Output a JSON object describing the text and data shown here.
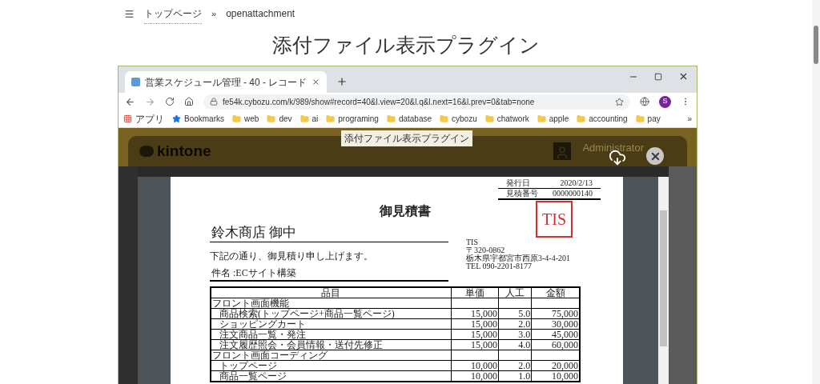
{
  "breadcrumb": {
    "items": [
      {
        "label": "トップページ",
        "kind": "link"
      },
      {
        "label": "openattachment",
        "kind": "current"
      }
    ],
    "separator": "»"
  },
  "page_title": "添付ファイル表示プラグイン",
  "browser": {
    "tab_title": "営業スケジュール管理 - 40 - レコード",
    "url": "fe54k.cybozu.com/k/989/show#record=40&l.view=20&l.q&l.next=16&l.prev=0&tab=none",
    "profile_letter": "S",
    "more_bookmarks": "»",
    "bookmarks": [
      {
        "label": "アプリ",
        "kind": "apps"
      },
      {
        "label": "Bookmarks",
        "kind": "star"
      },
      {
        "label": "web",
        "kind": "folder"
      },
      {
        "label": "dev",
        "kind": "folder"
      },
      {
        "label": "ai",
        "kind": "folder"
      },
      {
        "label": "programing",
        "kind": "folder"
      },
      {
        "label": "database",
        "kind": "folder"
      },
      {
        "label": "cybozu",
        "kind": "folder"
      },
      {
        "label": "chatwork",
        "kind": "folder"
      },
      {
        "label": "apple",
        "kind": "folder"
      },
      {
        "label": "accounting",
        "kind": "folder"
      },
      {
        "label": "pay",
        "kind": "folder"
      }
    ]
  },
  "app": {
    "logo": "kintone",
    "user": "Administrator",
    "tooltip": "添付ファイル表示プラグイン"
  },
  "document": {
    "issue_label": "発行日",
    "issue_date": "2020/2/13",
    "number_label": "見積番号",
    "number": "0000000140",
    "title": "御見積書",
    "recipient": "鈴木商店 御中",
    "intro": "下記の通り、御見積り申し上げます。",
    "subject": "件名 :ECサイト構築",
    "stamp": "TIS",
    "sender": [
      "TIS",
      "〒320-0862",
      "栃木県宇都宮市西原3-4-4-201",
      "TEL 090-2201-8177"
    ],
    "columns": [
      "品目",
      "単価",
      "人工",
      "金額"
    ],
    "rows": [
      {
        "kind": "section",
        "cells": [
          "フロント画面機能"
        ]
      },
      {
        "kind": "item",
        "cells": [
          "商品検索(トップページ+商品一覧ページ)",
          "15,000",
          "5.0",
          "75,000"
        ]
      },
      {
        "kind": "item",
        "cells": [
          "ショッピングカート",
          "15,000",
          "2.0",
          "30,000"
        ]
      },
      {
        "kind": "item",
        "cells": [
          "注文商品一覧・発注",
          "15,000",
          "3.0",
          "45,000"
        ]
      },
      {
        "kind": "item",
        "cells": [
          "注文履歴照会・会員情報・送付先修正",
          "15,000",
          "4.0",
          "60,000"
        ]
      },
      {
        "kind": "section",
        "cells": [
          "フロント画面コーディング"
        ]
      },
      {
        "kind": "item",
        "cells": [
          "トップページ",
          "10,000",
          "2.0",
          "20,000"
        ]
      },
      {
        "kind": "item",
        "cells": [
          "商品一覧ページ",
          "10,000",
          "1.0",
          "10,000"
        ]
      }
    ]
  }
}
